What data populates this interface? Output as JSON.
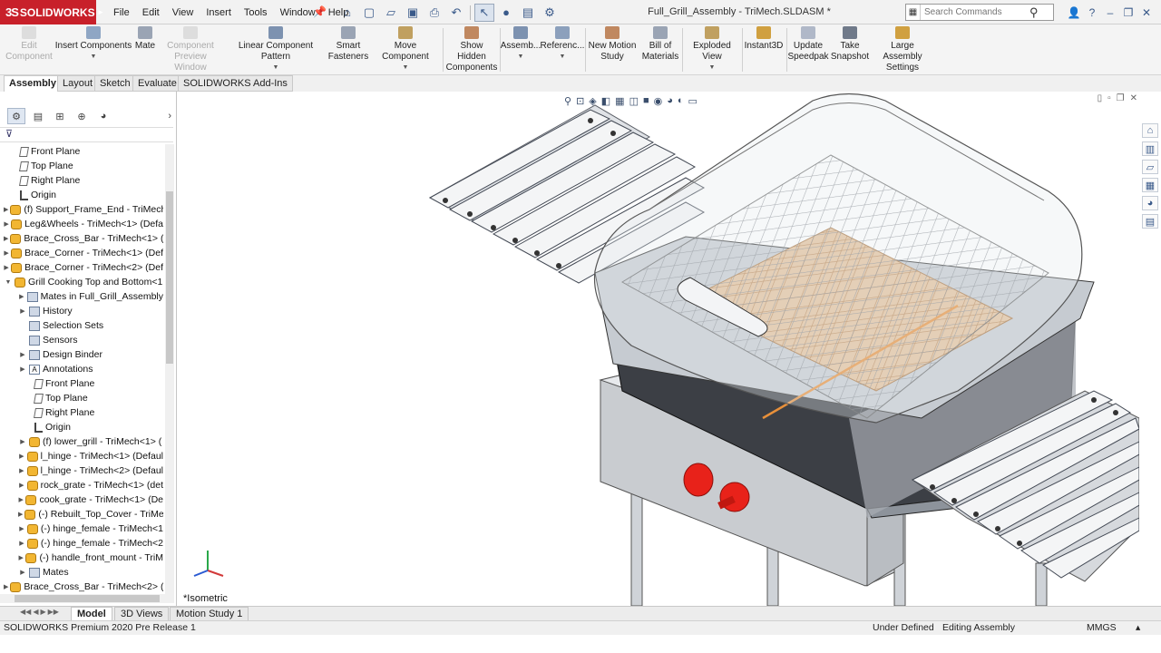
{
  "app": {
    "logo_text": "SOLIDWORKS",
    "document_title": "Full_Grill_Assembly - TriMech.SLDASM *"
  },
  "menu": [
    "File",
    "Edit",
    "View",
    "Insert",
    "Tools",
    "Window",
    "Help"
  ],
  "search": {
    "placeholder": "Search Commands"
  },
  "commands": [
    {
      "label_1": "Edit",
      "label_2": "Component",
      "disabled": true
    },
    {
      "label_1": "Insert Components",
      "label_2": "",
      "disabled": false
    },
    {
      "label_1": "Mate",
      "label_2": "",
      "disabled": false
    },
    {
      "label_1": "Component",
      "label_2": "Preview Window",
      "disabled": true
    },
    {
      "label_1": "Linear Component Pattern",
      "label_2": "",
      "disabled": false
    },
    {
      "label_1": "Smart",
      "label_2": "Fasteners",
      "disabled": false
    },
    {
      "label_1": "Move Component",
      "label_2": "",
      "disabled": false
    },
    {
      "label_1": "Show Hidden",
      "label_2": "Components",
      "disabled": false
    },
    {
      "label_1": "Assemb...",
      "label_2": "",
      "disabled": false
    },
    {
      "label_1": "Referenc...",
      "label_2": "",
      "disabled": false
    },
    {
      "label_1": "New Motion",
      "label_2": "Study",
      "disabled": false
    },
    {
      "label_1": "Bill of",
      "label_2": "Materials",
      "disabled": false
    },
    {
      "label_1": "Exploded View",
      "label_2": "",
      "disabled": false
    },
    {
      "label_1": "Instant3D",
      "label_2": "",
      "disabled": false
    },
    {
      "label_1": "Update",
      "label_2": "Speedpak",
      "disabled": false
    },
    {
      "label_1": "Take",
      "label_2": "Snapshot",
      "disabled": false
    },
    {
      "label_1": "Large Assembly",
      "label_2": "Settings",
      "disabled": false
    }
  ],
  "tabs": [
    "Assembly",
    "Layout",
    "Sketch",
    "Evaluate",
    "SOLIDWORKS Add-Ins"
  ],
  "tree": [
    "Front Plane",
    "Top Plane",
    "Right Plane",
    "Origin",
    "(f) Support_Frame_End - TriMech",
    "Leg&Wheels - TriMech<1> (Defa",
    "Brace_Cross_Bar - TriMech<1> (F",
    "Brace_Corner - TriMech<1> (Def",
    "Brace_Corner - TriMech<2> (Def",
    "Grill Cooking Top and Bottom<1",
    "Mates in Full_Grill_Assembly",
    "History",
    "Selection Sets",
    "Sensors",
    "Design Binder",
    "Annotations",
    "Front Plane",
    "Top Plane",
    "Right Plane",
    "Origin",
    "(f) lower_grill - TriMech<1> (",
    "l_hinge - TriMech<1> (Defaul",
    "l_hinge - TriMech<2> (Defaul",
    "rock_grate - TriMech<1> (det",
    "cook_grate - TriMech<1> (De",
    "(-) Rebuilt_Top_Cover - TriMe",
    "(-) hinge_female - TriMech<1",
    "(-) hinge_female - TriMech<2",
    "(-) handle_front_mount - TriM",
    "Mates",
    "Brace_Cross_Bar - TriMech<2> (F"
  ],
  "viewport": {
    "view_label": "*Isometric"
  },
  "bottom_tabs": [
    "Model",
    "3D Views",
    "Motion Study 1"
  ],
  "status": {
    "product": "SOLIDWORKS Premium 2020 Pre Release 1",
    "definition": "Under Defined",
    "mode": "Editing Assembly",
    "units": "MMGS"
  },
  "colors": {
    "brand": "#c8202a",
    "part_icon": "#f2b632",
    "knob": "#e8221a"
  }
}
